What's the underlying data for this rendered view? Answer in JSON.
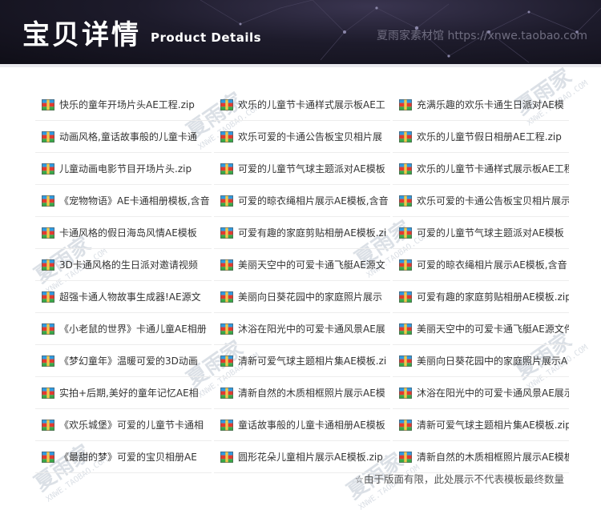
{
  "header": {
    "title_cn": "宝贝详情",
    "title_en": "Product Details",
    "watermark": "夏雨家素材馆 https://xnwe.taobao.com"
  },
  "watermark": {
    "brand": "夏雨家",
    "url": "XNWE.TAOBAO.COM"
  },
  "icon": "zip-archive-icon",
  "colors": {
    "header_bg": "#1d1b2b",
    "text": "#333333",
    "divider": "#ededed"
  },
  "columns": [
    [
      "快乐的童年开场片头AE工程.zip",
      "动画风格,童话故事般的儿童卡通",
      "儿童动画电影节目开场片头.zip",
      "《宠物物语》AE卡通相册模板,含音",
      "卡通风格的假日海岛风情AE模板",
      "3D卡通风格的生日派对邀请视频",
      "超强卡通人物故事生成器!AE源文",
      "《小老鼠的世界》卡通儿童AE相册",
      "《梦幻童年》温暖可爱的3D动画",
      "实拍+后期,美好的童年记忆AE相",
      "《欢乐城堡》可爱的儿童节卡通相",
      "《最甜的梦》可爱的宝贝相册AE"
    ],
    [
      "欢乐的儿童节卡通样式展示板AE工",
      "欢乐可爱的卡通公告板宝贝相片展",
      "可爱的儿童节气球主题派对AE模板",
      "可爱的晾衣绳相片展示AE模板,含音",
      "可爱有趣的家庭剪贴相册AE模板.zi",
      "美丽天空中的可爱卡通飞艇AE源文",
      "美丽向日葵花园中的家庭照片展示",
      "沐浴在阳光中的可爱卡通风景AE展",
      "清新可爱气球主题相片集AE模板.zi",
      "清新自然的木质相框照片展示AE模",
      "童话故事般的儿童卡通相册AE模板",
      "圆形花朵儿童相片展示AE模板.zip"
    ],
    [
      "充满乐趣的欢乐卡通生日派对AE模",
      "欢乐的儿童节假日相册AE工程.zip",
      "欢乐的儿童节卡通样式展示板AE工程",
      "欢乐可爱的卡通公告板宝贝相片展示",
      "可爱的儿童节气球主题派对AE模板",
      "可爱的晾衣绳相片展示AE模板,含音",
      "可爱有趣的家庭剪贴相册AE模板.zip",
      "美丽天空中的可爱卡通飞艇AE源文件",
      "美丽向日葵花园中的家庭照片展示A",
      "沐浴在阳光中的可爱卡通风景AE展示",
      "清新可爱气球主题相片集AE模板.zip",
      "清新自然的木质相框照片展示AE模板"
    ]
  ],
  "footer_note": "☆由于版面有限，此处展示不代表模板最终数量"
}
